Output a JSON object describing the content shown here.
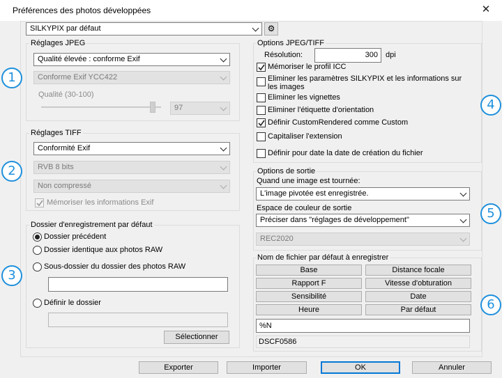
{
  "window": {
    "title": "Préférences des photos développées",
    "close_glyph": "✕"
  },
  "preset": {
    "selected": "SILKYPIX par défaut",
    "settings_glyph": "⚙"
  },
  "jpeg": {
    "title": "Réglages JPEG",
    "quality_select": "Qualité élevée : conforme Exif",
    "format_select": "Conforme Exif YCC422",
    "quality_label": "Qualité (30-100)",
    "quality_value": "97",
    "quality_level_percent": 95
  },
  "tiff": {
    "title": "Réglages TIFF",
    "conformity_select": "Conformité Exif",
    "bits_select": "RVB 8 bits",
    "compression_select": "Non compressé",
    "exif_checkbox": "Mémoriser les informations Exif"
  },
  "folder": {
    "title": "Dossier d'enregistrement par défaut",
    "options": [
      "Dossier précédent",
      "Dossier identique aux photos RAW",
      "Sous-dossier du dossier des photos RAW",
      "Définir le dossier"
    ],
    "subfolder_value": "",
    "folder_value": "",
    "select_button": "Sélectionner"
  },
  "options": {
    "title": "Options JPEG/TIFF",
    "resolution_label": "Résolution:",
    "resolution_value": "300",
    "resolution_unit": "dpi",
    "icc": "Mémoriser le profil ICC",
    "remove_params": "Eliminer les paramètres SILKYPIX  et les informations sur les images",
    "remove_thumbs": "Eliminer les vignettes",
    "remove_orientation": "Eliminer l'étiquette d'orientation",
    "custom_rendered": "Définir CustomRendered comme Custom",
    "capitalize_ext": "Capitaliser l'extension",
    "creation_date": "Définir pour date la date de création du fichier"
  },
  "output": {
    "title": "Options de sortie",
    "rotated_label": "Quand une image est tournée:",
    "rotated_select": "L'image pivotée est enregistrée.",
    "colorspace_label": "Espace de couleur de sortie",
    "colorspace_select": "Préciser dans \"réglages de développement\"",
    "rec_select": "REC2020"
  },
  "filename": {
    "title": "Nom de fichier par défaut à enregistrer",
    "buttons": [
      "Base",
      "Distance focale",
      "Rapport F",
      "Vitesse d'obturation",
      "Sensibilité",
      "Date",
      "Heure",
      "Par défaut"
    ],
    "pattern": "%N",
    "preview": "DSCF0586"
  },
  "footer": {
    "export": "Exporter",
    "import": "Importer",
    "ok": "OK",
    "cancel": "Annuler"
  },
  "callouts": [
    "1",
    "2",
    "3",
    "4",
    "5",
    "6"
  ],
  "colors": {
    "callout": "#1e90dc",
    "primary_border": "#0078d7"
  }
}
